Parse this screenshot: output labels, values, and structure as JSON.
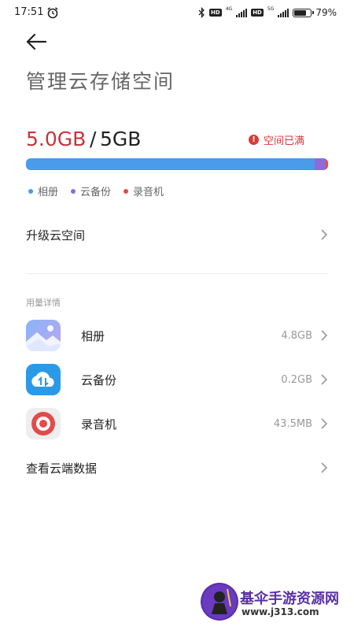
{
  "status_bar": {
    "time": "17:51",
    "hd_label": "HD",
    "net_4g": "4G",
    "net_5g": "5G",
    "battery_text": "79%",
    "battery_level": 0.79
  },
  "header": {
    "title": "管理云存储空间"
  },
  "storage": {
    "used": "5.0GB",
    "separator": "/",
    "total": "5GB",
    "warning": "空间已满",
    "segments": [
      {
        "name": "相册",
        "fraction": 0.955,
        "color": "#4a9bea"
      },
      {
        "name": "云备份",
        "fraction": 0.038,
        "color": "#8e6bd8"
      },
      {
        "name": "录音机",
        "fraction": 0.007,
        "color": "#e24b4b"
      }
    ],
    "legend": [
      {
        "label": "相册",
        "color": "#4a9bea"
      },
      {
        "label": "云备份",
        "color": "#8e6bd8"
      },
      {
        "label": "录音机",
        "color": "#e24b4b"
      }
    ]
  },
  "upgrade": {
    "label": "升级云空间"
  },
  "usage_details": {
    "header": "用量详情",
    "apps": [
      {
        "name": "相册",
        "size": "4.8GB",
        "icon": "album-icon"
      },
      {
        "name": "云备份",
        "size": "0.2GB",
        "icon": "cloud-backup-icon"
      },
      {
        "name": "录音机",
        "size": "43.5MB",
        "icon": "recorder-icon"
      }
    ]
  },
  "cloud_data": {
    "label": "查看云端数据"
  },
  "watermark": {
    "title": "基伞手游资源网",
    "url": "www.j313.com"
  },
  "colors": {
    "accent_red": "#c8343a",
    "album_blue": "#4a9bea",
    "backup_purple": "#8e6bd8",
    "recorder_red": "#e24b4b"
  }
}
